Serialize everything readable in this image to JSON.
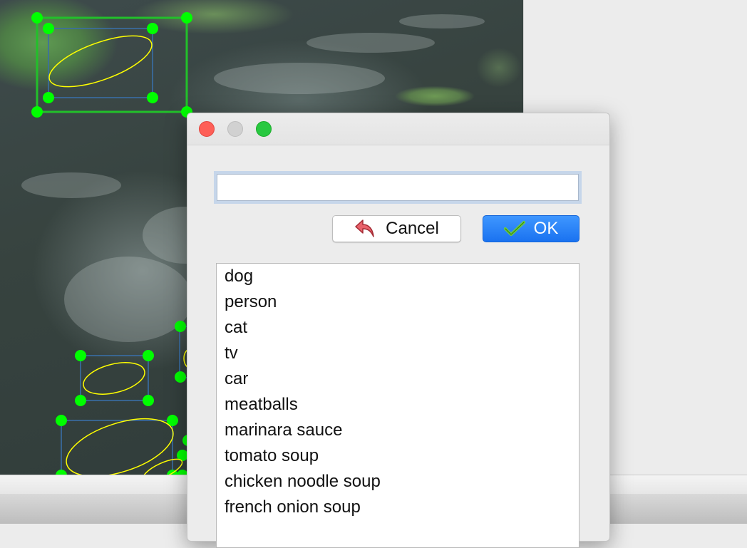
{
  "canvas": {
    "description_icon": "satellite-image",
    "shape_color": "#00ff00",
    "ellipse_color": "#ffff00"
  },
  "dialog": {
    "input": {
      "value": "",
      "placeholder": ""
    },
    "cancel_label": "Cancel",
    "ok_label": "OK",
    "cancel_icon": "undo-arrow-icon",
    "ok_icon": "checkmark-icon",
    "labels": [
      "dog",
      "person",
      "cat",
      "tv",
      "car",
      "meatballs",
      "marinara sauce",
      "tomato soup",
      "chicken noodle soup",
      "french onion soup"
    ]
  },
  "colors": {
    "accent": "#1a72f0",
    "close": "#fe5f57",
    "minimize": "#d1d1d1",
    "maximize": "#28c840"
  }
}
